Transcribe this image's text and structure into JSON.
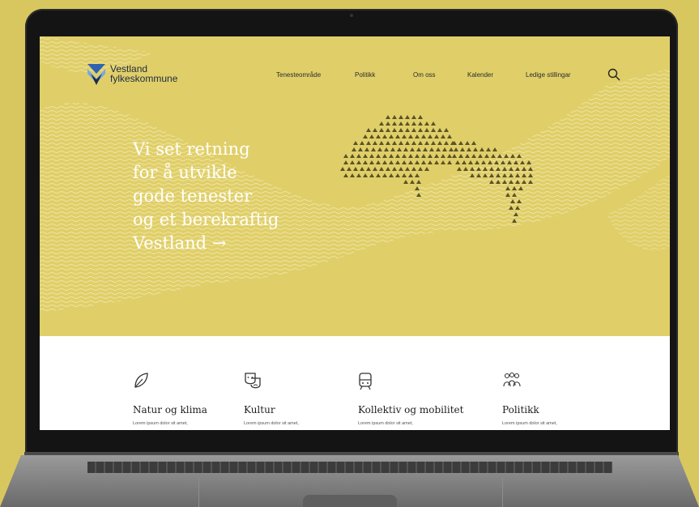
{
  "site": {
    "logo": {
      "line1": "Vestland",
      "line2": "fylkeskommune"
    },
    "nav": [
      "Tenesteområde",
      "Politikk",
      "Om oss",
      "Kalender",
      "Ledige stillingar"
    ],
    "search_icon": "search-icon"
  },
  "hero": {
    "lines": [
      "Vi set retning",
      "for å utvikle",
      "gode tenester",
      "og et berekraftig",
      "Vestland →"
    ]
  },
  "cards": [
    {
      "title": "Natur og klima",
      "text": "Lorem ipsum dolor sit amet,",
      "icon": "leaf-icon"
    },
    {
      "title": "Kultur",
      "text": "Lorem ipsum dolor sit amet,",
      "icon": "theater-masks-icon"
    },
    {
      "title": "Kollektiv og mobilitet",
      "text": "Lorem ipsum dolor sit amet,",
      "icon": "train-icon"
    },
    {
      "title": "Politikk",
      "text": "Lorem ipsum dolor sit amet,",
      "icon": "people-icon"
    }
  ],
  "colors": {
    "background": "#d8c75e",
    "hero": "#e0cf69",
    "logo_blue": "#2f63b0",
    "text_dark": "#1f2a44"
  }
}
